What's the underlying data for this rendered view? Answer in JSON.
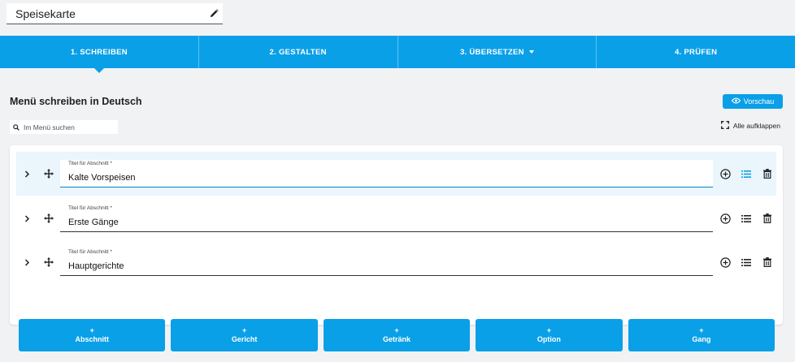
{
  "menu_title": "Speisekarte",
  "tabs": [
    {
      "label": "1. SCHREIBEN",
      "active": true
    },
    {
      "label": "2. GESTALTEN"
    },
    {
      "label": "3. ÜBERSETZEN"
    },
    {
      "label": "4. PRÜFEN"
    }
  ],
  "heading": "Menü schreiben in Deutsch",
  "preview_label": "Vorschau",
  "search_placeholder": "Im Menü suchen",
  "expand_all_label": "Alle aufklappen",
  "field_label": "Titel für Abschnitt *",
  "sections": [
    {
      "title": "Kalte Vorspeisen"
    },
    {
      "title": "Erste Gänge"
    },
    {
      "title": "Hauptgerichte"
    }
  ],
  "add_buttons": {
    "plus": "+",
    "section": "Abschnitt",
    "dish": "Gericht",
    "drink": "Getränk",
    "option": "Option",
    "course": "Gang"
  },
  "colors": {
    "accent": "#0aa0e8",
    "highlight_row": "#eaf5fc",
    "background": "#f1f2f4"
  }
}
